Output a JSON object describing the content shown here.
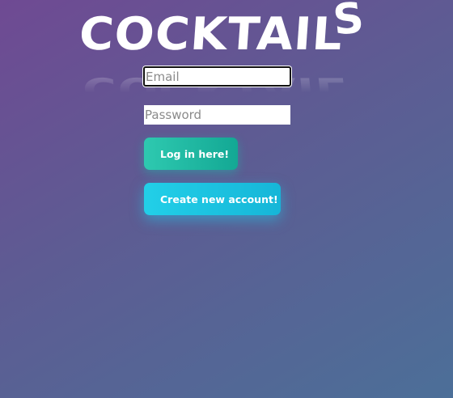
{
  "logo": {
    "main_text": "COCKTAIL",
    "tail_text": "S"
  },
  "login_form": {
    "email": {
      "placeholder": "Email",
      "value": ""
    },
    "password": {
      "placeholder": "Password",
      "value": ""
    },
    "login_button_label": "Log in here!",
    "create_account_button_label": "Create new account!"
  },
  "colors": {
    "background_start": "#6f4a93",
    "background_end": "#4c6f98",
    "login_button": "#1fb8a2",
    "create_account_button": "#1cc4e2"
  }
}
